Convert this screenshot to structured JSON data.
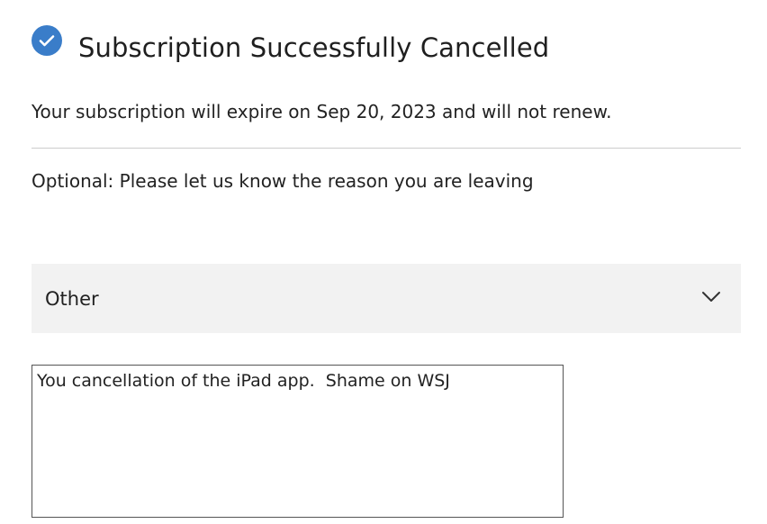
{
  "header": {
    "icon": "check-circle-icon",
    "title": "Subscription Successfully Cancelled"
  },
  "message": {
    "expire_text": "Your subscription will expire on Sep 20, 2023 and will not renew."
  },
  "feedback": {
    "prompt": "Optional: Please let us know the reason you are leaving",
    "reason_select": {
      "selected": "Other",
      "icon": "chevron-down-icon"
    },
    "comment_value": "You cancellation of the iPad app.  Shame on WSJ"
  },
  "colors": {
    "accent": "#3a7dc9",
    "select_background": "#f2f2f2",
    "divider": "#cccccc"
  }
}
